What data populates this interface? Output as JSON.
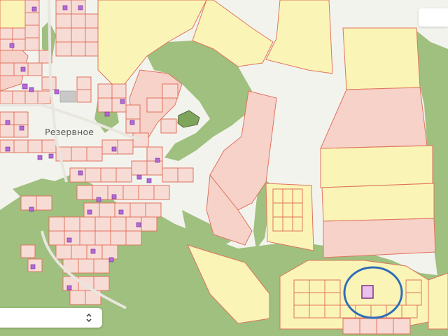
{
  "map": {
    "place_label": "Резервное",
    "highlight_color": "#2f6bb8",
    "plot_outline_color": "#e0735e",
    "forest_color": "#9fc07e",
    "building_color": "#b36ad8"
  },
  "controls": {
    "layer_select_value": "",
    "top_right_control": ""
  }
}
